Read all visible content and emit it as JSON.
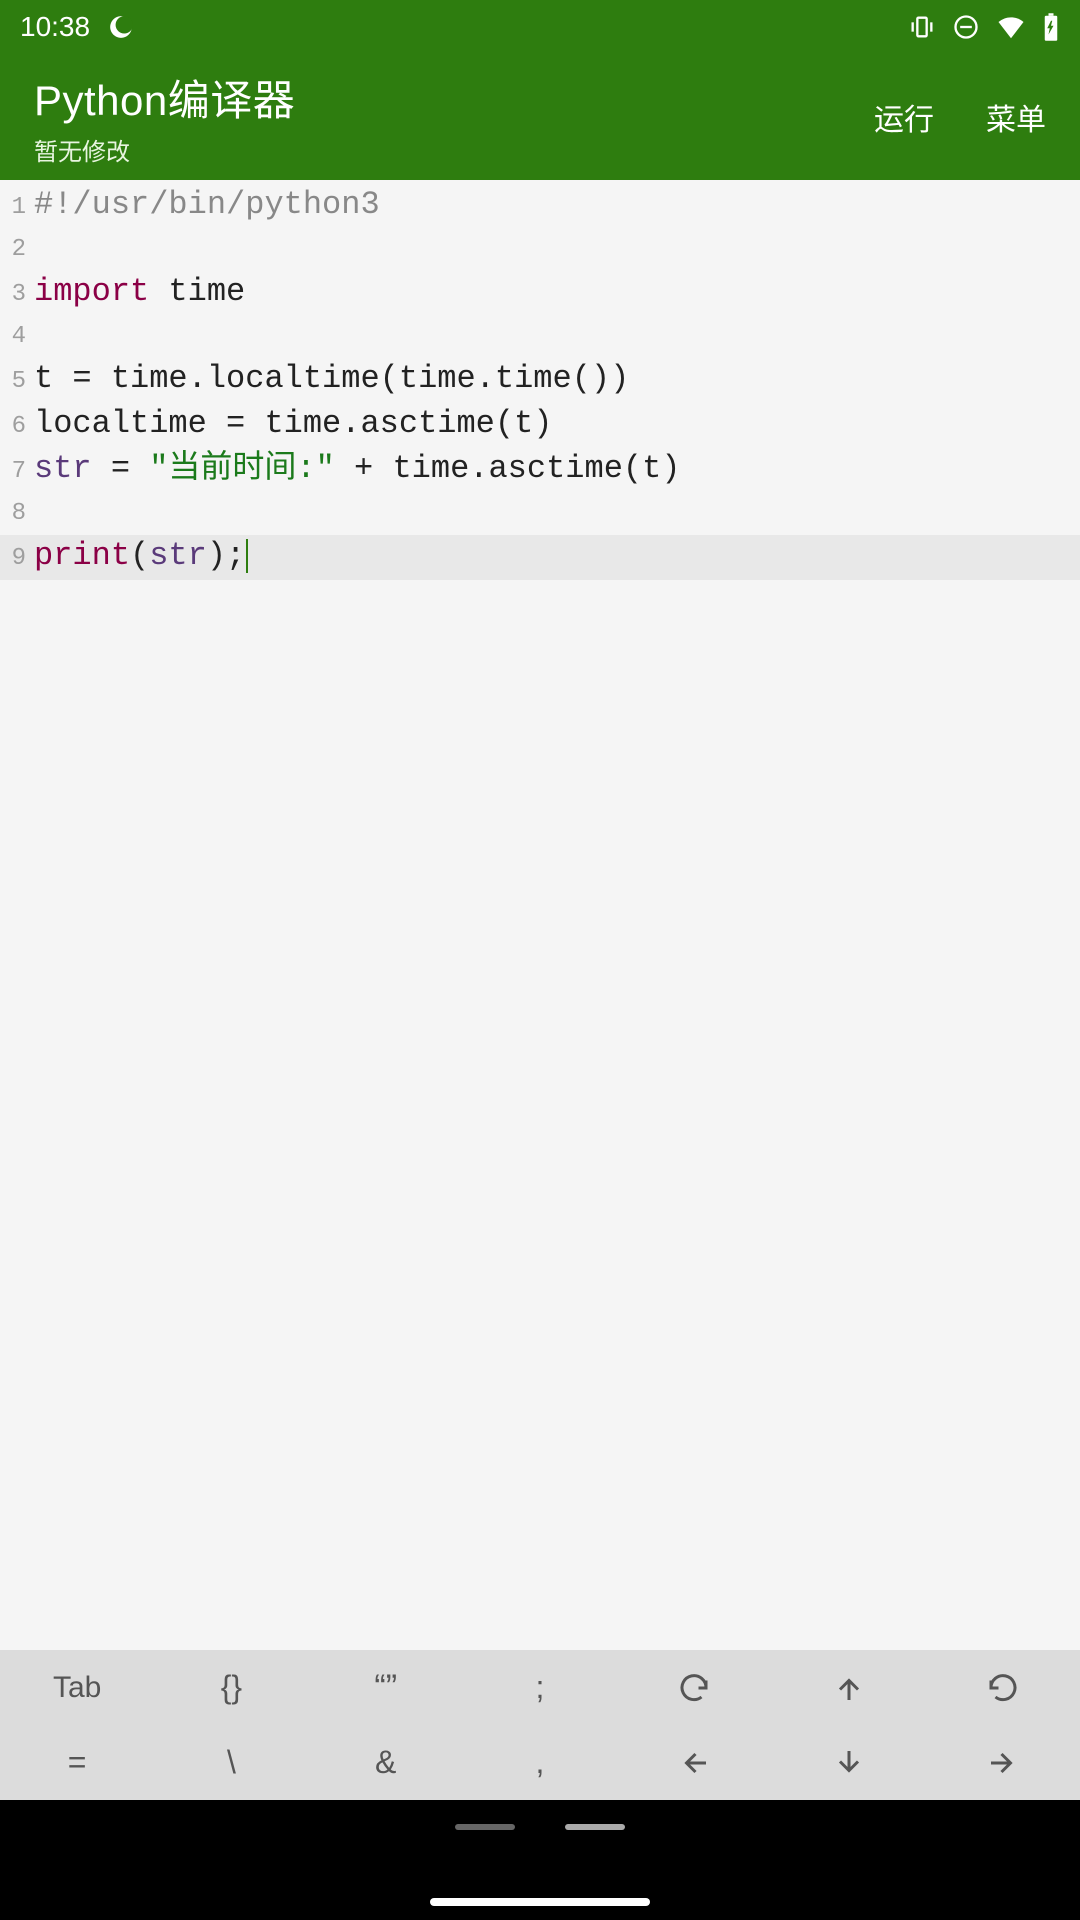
{
  "status_bar": {
    "time": "10:38",
    "icons": [
      "moon-icon",
      "vibrate-icon",
      "dnd-icon",
      "wifi-icon",
      "battery-icon"
    ]
  },
  "header": {
    "title": "Python编译器",
    "subtitle": "暂无修改",
    "actions": {
      "run": "运行",
      "menu": "菜单"
    }
  },
  "code": {
    "lines": [
      {
        "n": "1",
        "tokens": [
          {
            "t": "#!/usr/bin/python3",
            "c": "tk-comment"
          }
        ]
      },
      {
        "n": "2",
        "tokens": []
      },
      {
        "n": "3",
        "tokens": [
          {
            "t": "import",
            "c": "tk-keyword"
          },
          {
            "t": " ",
            "c": ""
          },
          {
            "t": "time",
            "c": "tk-module"
          }
        ]
      },
      {
        "n": "4",
        "tokens": []
      },
      {
        "n": "5",
        "tokens": [
          {
            "t": "t = time.localtime(time.time())",
            "c": ""
          }
        ]
      },
      {
        "n": "6",
        "tokens": [
          {
            "t": "localtime = time.asctime(t)",
            "c": ""
          }
        ]
      },
      {
        "n": "7",
        "tokens": [
          {
            "t": "str",
            "c": "tk-ident"
          },
          {
            "t": " = ",
            "c": ""
          },
          {
            "t": "\"当前时间:\"",
            "c": "tk-string"
          },
          {
            "t": " + time.asctime(t)",
            "c": ""
          }
        ]
      },
      {
        "n": "8",
        "tokens": []
      },
      {
        "n": "9",
        "tokens": [
          {
            "t": "print",
            "c": "tk-builtin"
          },
          {
            "t": "(",
            "c": ""
          },
          {
            "t": "str",
            "c": "tk-ident"
          },
          {
            "t": ");",
            "c": ""
          }
        ],
        "current": true,
        "cursor": true
      }
    ]
  },
  "toolbar": {
    "row1": [
      "Tab",
      "{}",
      "\"\"",
      ";",
      "undo-icon",
      "arrow-up-icon",
      "redo-icon"
    ],
    "row2": [
      "=",
      "\\",
      "&",
      ",",
      "arrow-left-icon",
      "arrow-down-icon",
      "arrow-right-icon"
    ]
  }
}
